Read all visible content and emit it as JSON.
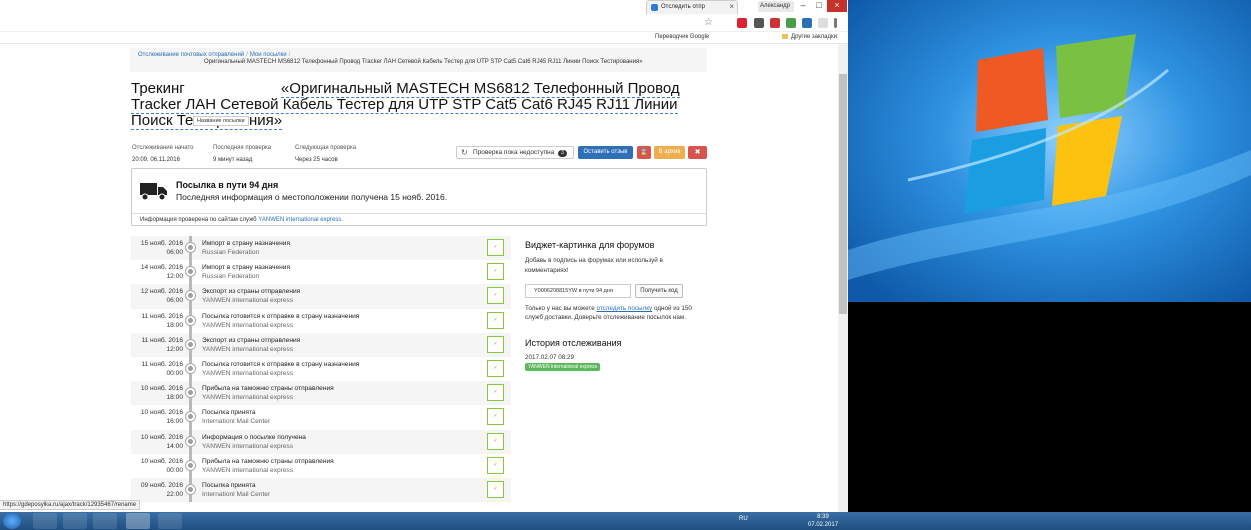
{
  "browser": {
    "tab_title": "Отследить отпр",
    "user_name": "Александр",
    "bookmarks": [
      "Переводчик Google",
      "Другие закладки"
    ]
  },
  "page": {
    "breadcrumb": {
      "items": [
        "Отслеживание почтовых отправлений",
        "Мои посылки"
      ],
      "current": "Оригинальный MASTECH MS6812 Телефонный Провод Tracker ЛАН Сетевой Кабель Тестер для UTP STP Cat5 Cat6 RJ45 RJ11 Линии Поиск Тестирования»"
    },
    "title_label": "Трекинг",
    "title_name": "«Оригинальный MASTECH MS6812 Телефонный Провод Tracker ЛАН Сетевой Кабель Тестер для UTP STP Cat5 Cat6 RJ45 RJ11 Линии Поиск Тестирования»",
    "tooltip": "Название посылки",
    "meta": {
      "started_label": "Отслеживание начато",
      "started_value": "20:09, 06.11.2016",
      "last_label": "Последняя проверка",
      "last_value": "9 минут назад",
      "next_label": "Следующая проверка",
      "next_value": "Через 25 часов"
    },
    "actions": {
      "check_label": "Проверка пока недоступна",
      "check_count": "3",
      "review_label": "Оставить отзыв",
      "trash_icon": "hourglass-icon",
      "archive_label": "В архив",
      "delete_icon": "x-icon"
    },
    "status": {
      "title": "Посылка в пути 94 дня",
      "subtitle": "Последняя информация о местоположении получена 15 нояб. 2016.",
      "footer_prefix": "Информация проверена по сайтам служб",
      "footer_service": "YANWEN international express."
    },
    "events": [
      {
        "date": "15 нояб. 2016",
        "time": "06:00",
        "title": "Импорт в страну назначения",
        "place": "Russian Federation"
      },
      {
        "date": "14 нояб. 2016",
        "time": "12:00",
        "title": "Импорт в страну назначения",
        "place": "Russian Federation"
      },
      {
        "date": "12 нояб. 2016",
        "time": "06:00",
        "title": "Экспорт из страны отправления",
        "place": "YANWEN international express"
      },
      {
        "date": "11 нояб. 2016",
        "time": "18:00",
        "title": "Посылка готовится к отправке в страну назначения",
        "place": "YANWEN international express"
      },
      {
        "date": "11 нояб. 2016",
        "time": "12:00",
        "title": "Экспорт из страны отправления",
        "place": "YANWEN international express"
      },
      {
        "date": "11 нояб. 2016",
        "time": "00:00",
        "title": "Посылка готовится к отправке в страну назначения",
        "place": "YANWEN international express"
      },
      {
        "date": "10 нояб. 2016",
        "time": "18:00",
        "title": "Прибыла на таможню страны отправления",
        "place": "YANWEN international express"
      },
      {
        "date": "10 нояб. 2016",
        "time": "16:00",
        "title": "Посылка принята",
        "place": "Internationl Mail Center"
      },
      {
        "date": "10 нояб. 2016",
        "time": "14:00",
        "title": "Информация о посылке получена",
        "place": "YANWEN international express"
      },
      {
        "date": "10 нояб. 2016",
        "time": "00:00",
        "title": "Прибыла на таможню страны отправления",
        "place": "YANWEN international express"
      },
      {
        "date": "09 нояб. 2016",
        "time": "22:00",
        "title": "Посылка принята",
        "place": "Internationl Mail Center"
      }
    ],
    "widget": {
      "title": "Виджет-картинка для форумов",
      "desc": "Добавь в подпись на форумах или используй в комментариях!",
      "code_value": "Y0006208815YW в пути 94 дня",
      "button_label": "Получить код",
      "note_prefix": "Только у нас вы можете",
      "note_link": "отследить посылку",
      "note_suffix": "одной из 150 служб доставки. Доверьте отслеживание посылок нам."
    },
    "history": {
      "title": "История отслеживания",
      "date": "2017.02.07 08:29",
      "badge": "YANWEN international express"
    },
    "status_url": "https://gdeposylka.ru/ajax/track/12935467/rename"
  },
  "taskbar": {
    "lang": "RU",
    "time": "8:39",
    "date": "07.02.2017"
  }
}
